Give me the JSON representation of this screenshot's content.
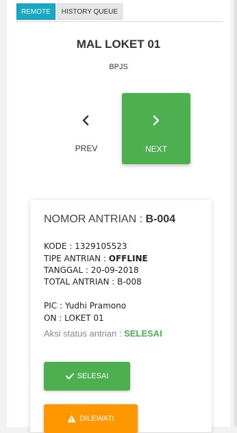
{
  "tabs": [
    {
      "label": "REMOTE",
      "active": true
    },
    {
      "label": "HISTORY QUEUE",
      "active": false
    }
  ],
  "header": {
    "title": "MAL LOKET 01",
    "subtitle": "BPJS"
  },
  "nav": {
    "prev_label": "PREV",
    "next_label": "NEXT"
  },
  "card": {
    "queue_label": "NOMOR ANTRIAN : ",
    "queue_number": "B-004",
    "kode_label": "KODE : ",
    "kode_value": "1329105523",
    "tipe_label": "TIPE ANTRIAN : ",
    "tipe_value": "OFFLINE",
    "tanggal_label": "TANGGAL : ",
    "tanggal_value": "20-09-2018",
    "total_label": "TOTAL ANTRIAN : ",
    "total_value": "B-008",
    "pic_label": "PIC : ",
    "pic_value": "Yudhi Pramono",
    "on_label": "ON : ",
    "on_value": "LOKET 01",
    "aksi_label": "Aksi status antrian : ",
    "aksi_value": "SELESAI"
  },
  "actions": {
    "selesai_label": "SELESAI",
    "dilewati_label": "DILEWATI"
  },
  "colors": {
    "accent_tab": "#17a8c6",
    "success": "#4caf50",
    "warning": "#ff9800"
  },
  "icons": {
    "prev": "chevron-left-icon",
    "next": "chevron-right-icon",
    "selesai": "check-icon",
    "dilewati": "warning-icon"
  }
}
